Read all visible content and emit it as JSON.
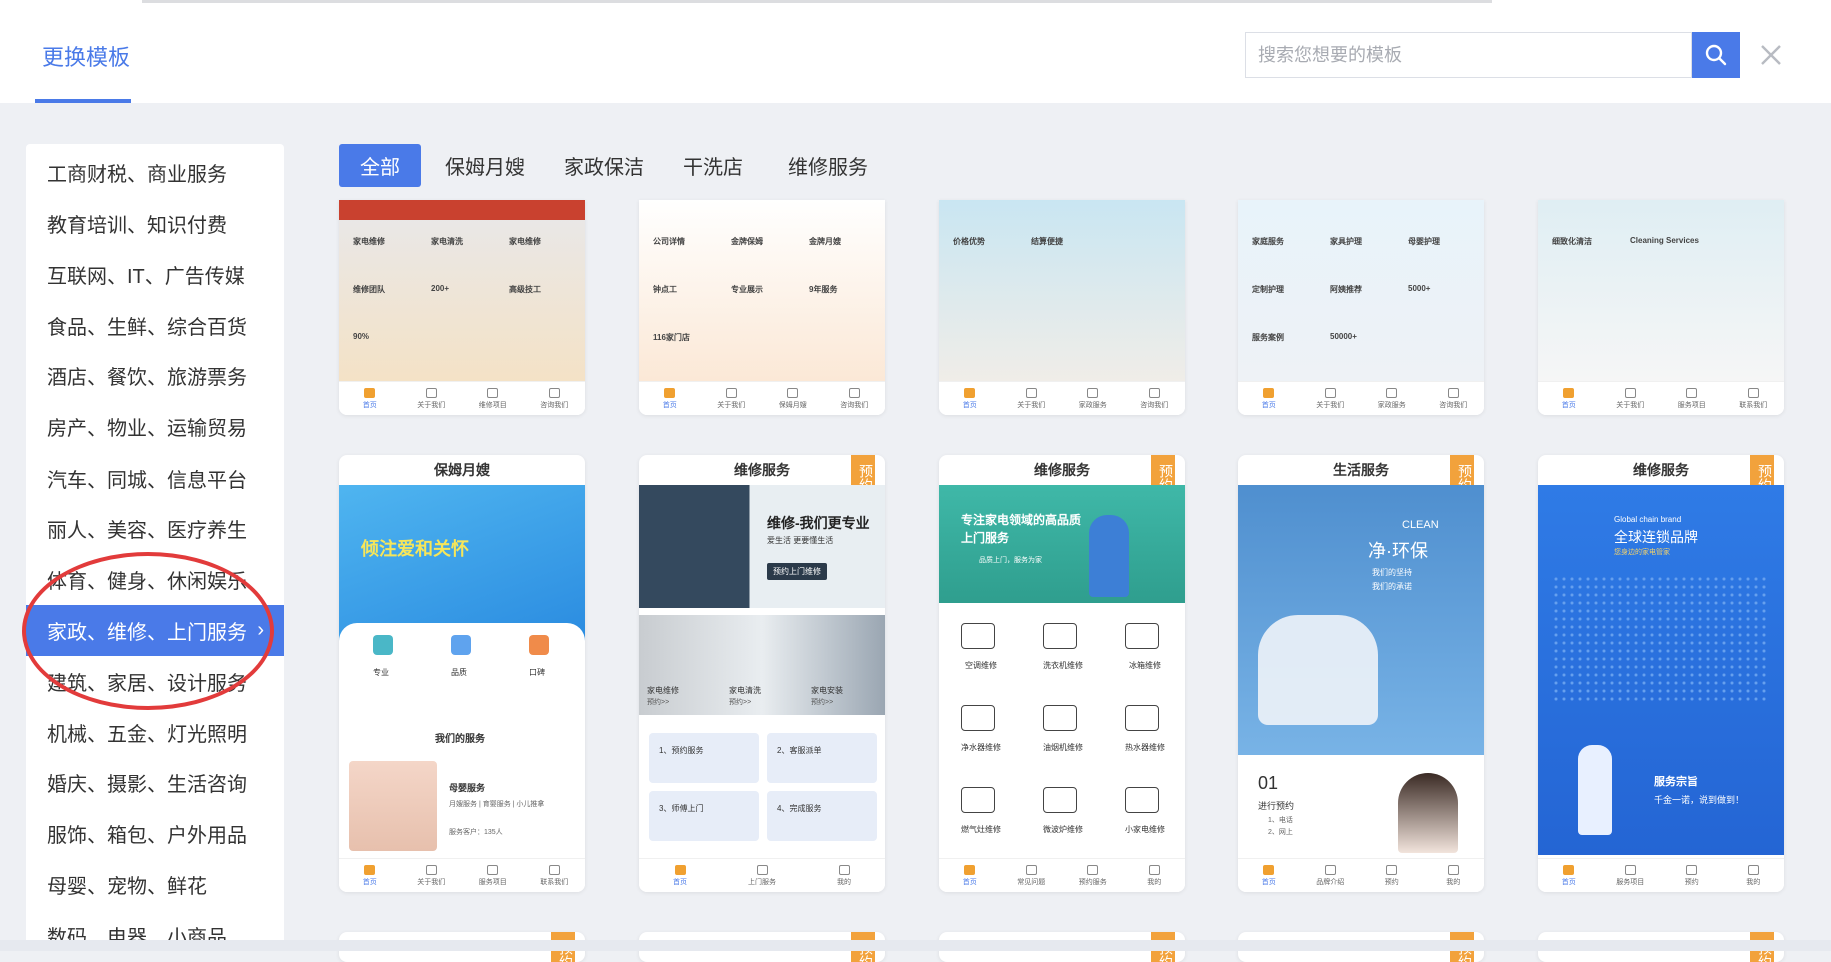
{
  "header": {
    "tab_title": "更换模板",
    "search": {
      "placeholder": "搜索您想要的模板"
    }
  },
  "sidebar": {
    "items": [
      {
        "label": "工商财税、商业服务"
      },
      {
        "label": "教育培训、知识付费"
      },
      {
        "label": "互联网、IT、广告传媒"
      },
      {
        "label": "食品、生鲜、综合百货"
      },
      {
        "label": "酒店、餐饮、旅游票务"
      },
      {
        "label": "房产、物业、运输贸易"
      },
      {
        "label": "汽车、同城、信息平台"
      },
      {
        "label": "丽人、美容、医疗养生"
      },
      {
        "label": "体育、健身、休闲娱乐"
      },
      {
        "label": "家政、维修、上门服务",
        "active": true
      },
      {
        "label": "建筑、家居、设计服务"
      },
      {
        "label": "机械、五金、灯光照明"
      },
      {
        "label": "婚庆、摄影、生活咨询"
      },
      {
        "label": "服饰、箱包、户外用品"
      },
      {
        "label": "母婴、宠物、鲜花"
      },
      {
        "label": "数码、电器、小商品"
      }
    ]
  },
  "filters": [
    "全部",
    "保姆月嫂",
    "家政保洁",
    "干洗店",
    "维修服务"
  ],
  "ribbon_text": "预约",
  "top_cards": [
    {
      "snippets": [
        "家电维修",
        "家电清洗",
        "家电维修",
        "维修团队",
        "200+",
        "高级技工",
        "90%"
      ],
      "nav": [
        "首页",
        "关于我们",
        "维修项目",
        "咨询我们"
      ]
    },
    {
      "snippets": [
        "公司详情",
        "金牌保姆",
        "金牌月嫂",
        "钟点工",
        "专业展示",
        "9年服务",
        "116家门店"
      ],
      "nav": [
        "首页",
        "关于我们",
        "保姆月嫂",
        "咨询我们"
      ]
    },
    {
      "snippets": [
        "价格优势",
        "结算便捷"
      ],
      "nav": [
        "首页",
        "关于我们",
        "家政服务",
        "咨询我们"
      ]
    },
    {
      "snippets": [
        "家庭服务",
        "家具护理",
        "母婴护理",
        "定制护理",
        "阿姨推荐",
        "5000+",
        "服务案例",
        "50000+"
      ],
      "nav": [
        "首页",
        "关于我们",
        "家政服务",
        "咨询我们"
      ]
    },
    {
      "snippets": [
        "细致化清洁",
        "Cleaning Services"
      ],
      "nav": [
        "首页",
        "关于我们",
        "服务项目",
        "联系我们"
      ]
    }
  ],
  "cards": [
    {
      "title": "保姆月嫂",
      "ribbon": false,
      "banner": "倾注爱和关怀",
      "features": [
        "专业",
        "品质",
        "口碑"
      ],
      "section": "我们的服务",
      "service": "母婴服务",
      "service_desc": "月嫂服务 | 育婴服务 | 小儿推拿",
      "service_count": "服务客户：135人",
      "nav": [
        "首页",
        "关于我们",
        "服务项目",
        "联系我们"
      ]
    },
    {
      "title": "维修服务",
      "ribbon": true,
      "banner": "维修-我们更专业",
      "banner_sub": "爱生活 更要懂生活",
      "banner_btn": "预约上门维修",
      "mid": [
        "家电维修",
        "家电清洗",
        "家电安装"
      ],
      "mid_sub": "预约>>",
      "steps": [
        "1、预约服务",
        "2、客服派单",
        "3、师傅上门",
        "4、完成服务"
      ],
      "nav": [
        "首页",
        "上门服务",
        "我的"
      ]
    },
    {
      "title": "维修服务",
      "ribbon": true,
      "banner": "专注家电领域的高品质上门服务",
      "banner_sub": "品质上门，服务为家",
      "grid": [
        "空调维修",
        "洗衣机维修",
        "冰箱维修",
        "净水器维修",
        "油烟机维修",
        "热水器维修",
        "燃气灶维修",
        "微波炉维修",
        "小家电维修"
      ],
      "nav": [
        "首页",
        "常见问题",
        "预约服务",
        "我的"
      ]
    },
    {
      "title": "生活服务",
      "ribbon": true,
      "banner_en": "CLEAN",
      "banner": "净·环保",
      "banner_sub1": "我们的坚持",
      "banner_sub2": "我们的承诺",
      "step_no": "01",
      "step_title": "进行预约",
      "step_items": [
        "1、电话",
        "2、网上"
      ],
      "nav": [
        "首页",
        "品牌介绍",
        "预约",
        "我的"
      ]
    },
    {
      "title": "维修服务",
      "ribbon": true,
      "banner_small": "Global chain brand",
      "banner": "全球连锁品牌",
      "banner_sub": "您身边的家电管家",
      "tagline": "服务宗旨",
      "tagline_sub": "千金一诺，说到做到！",
      "nav": [
        "首页",
        "服务项目",
        "预约",
        "我的"
      ]
    }
  ],
  "colors": {
    "accent": "#4a7ae8",
    "ribbon": "#f2a23c",
    "annotation": "#e23b3b"
  },
  "icons": [
    "search-icon",
    "close-icon",
    "chevron-right-icon"
  ]
}
